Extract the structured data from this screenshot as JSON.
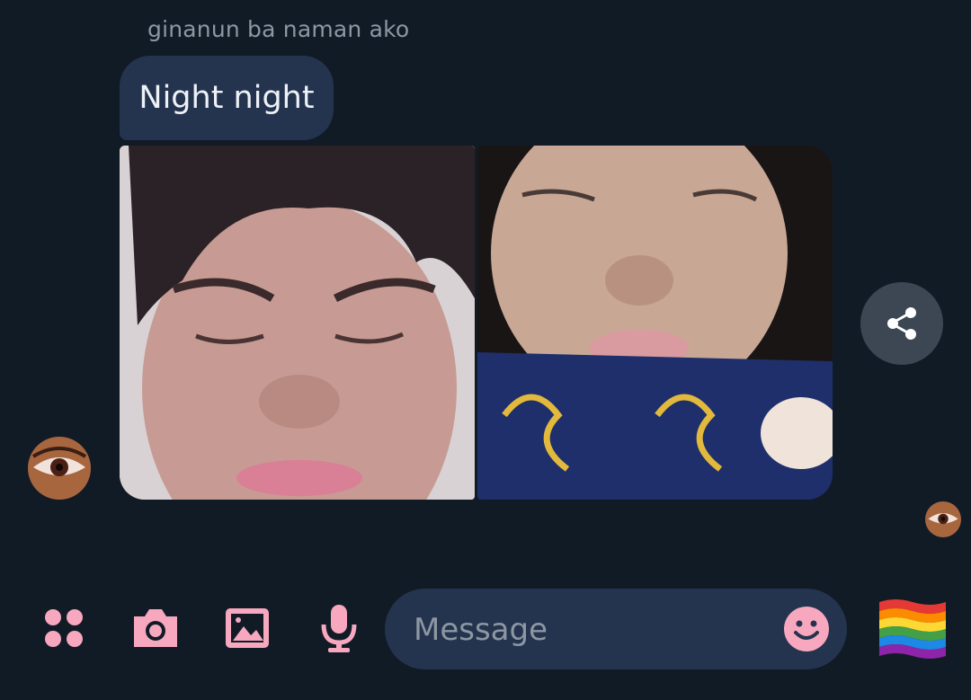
{
  "conversation": {
    "previous_message_text": "ginanun ba naman ako",
    "last_message_text": "Night night",
    "photos": [
      {
        "name": "sleeping-boy-photo"
      },
      {
        "name": "sleeping-girl-photo"
      }
    ]
  },
  "composer": {
    "placeholder": "Message",
    "value": ""
  },
  "icons": {
    "apps": "apps-grid-icon",
    "camera": "camera-icon",
    "gallery": "gallery-icon",
    "mic": "mic-icon",
    "emoji": "smiley-icon",
    "share": "share-icon",
    "sticker": "rainbow-flag-icon"
  },
  "colors": {
    "background": "#111b26",
    "bubble": "#24344f",
    "accent_pink": "#f7a8bf",
    "muted_text": "#8d97a3"
  }
}
